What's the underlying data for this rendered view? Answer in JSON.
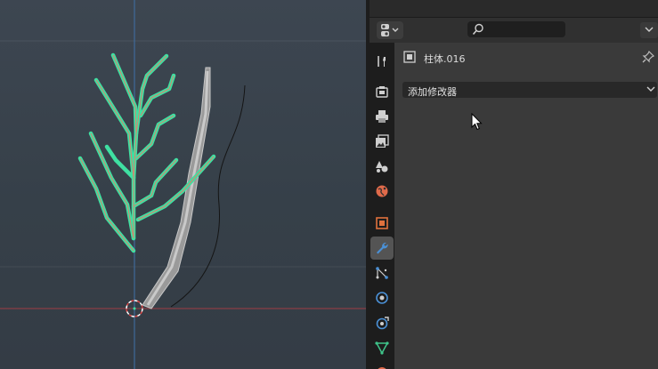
{
  "properties": {
    "object_name": "柱体.016",
    "add_modifier_label": "添加修改器",
    "search_placeholder": "",
    "tabs": [
      {
        "id": "tool",
        "icon": "wrench-screwdriver-icon"
      },
      {
        "id": "render",
        "icon": "camera-back-icon"
      },
      {
        "id": "output",
        "icon": "printer-icon"
      },
      {
        "id": "view-layer",
        "icon": "image-stack-icon"
      },
      {
        "id": "scene",
        "icon": "scene-shapes-icon"
      },
      {
        "id": "world",
        "icon": "globe-icon"
      },
      {
        "id": "object",
        "icon": "object-square-icon"
      },
      {
        "id": "modifiers",
        "icon": "wrench-icon",
        "active": true
      },
      {
        "id": "particles",
        "icon": "particles-icon"
      },
      {
        "id": "physics",
        "icon": "physics-orbit-icon"
      },
      {
        "id": "constraints",
        "icon": "constraint-icon"
      },
      {
        "id": "data",
        "icon": "mesh-triangle-icon"
      }
    ]
  },
  "colors": {
    "selection_outline": "#3fe0a2",
    "active_tab": "#545454",
    "panel_bg": "#3a3a3a",
    "accent_orange": "#e0713d",
    "accent_blue": "#4a90d6"
  }
}
